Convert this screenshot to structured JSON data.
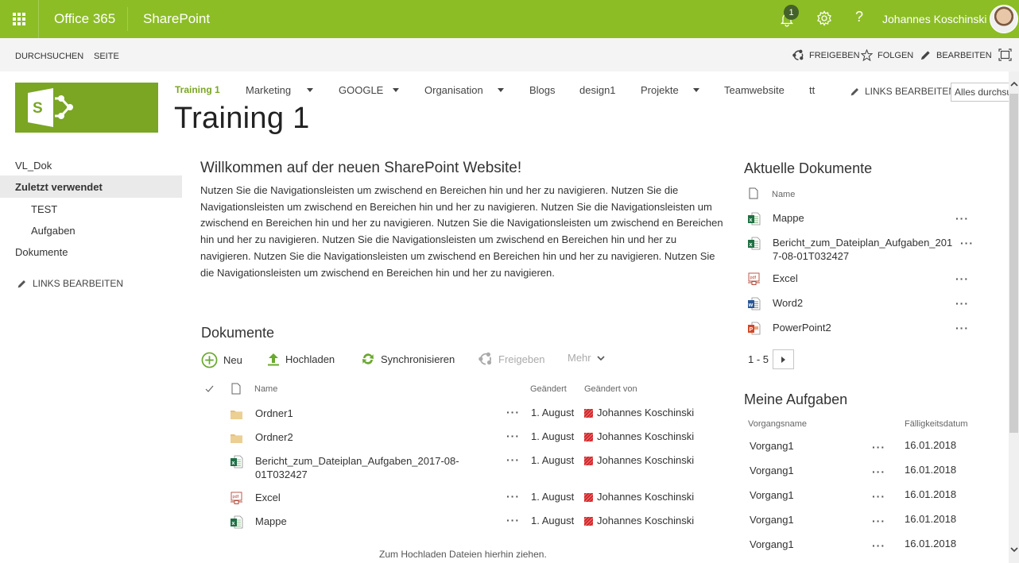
{
  "suitebar": {
    "brand": "Office 365",
    "app": "SharePoint",
    "notification_count": "1",
    "help_label": "?",
    "user_name": "Johannes Koschinski",
    "accent_color": "#8cbd25"
  },
  "ribbon": {
    "tabs": [
      "DURCHSUCHEN",
      "SEITE"
    ],
    "actions": {
      "share": "FREIGEBEN",
      "follow": "FOLGEN",
      "edit": "BEARBEITEN"
    }
  },
  "site": {
    "title": "Training 1",
    "topnav": [
      {
        "label": "Training 1",
        "active": true,
        "dropdown": false
      },
      {
        "label": "Marketing",
        "dropdown": true
      },
      {
        "label": "GOOGLE",
        "dropdown": true
      },
      {
        "label": "Organisation",
        "dropdown": true
      },
      {
        "label": "Blogs",
        "dropdown": false
      },
      {
        "label": "design1",
        "dropdown": false
      },
      {
        "label": "Projekte",
        "dropdown": true
      },
      {
        "label": "Teamwebsite",
        "dropdown": false
      },
      {
        "label": "tt",
        "dropdown": false
      }
    ],
    "links_edit": "LINKS BEARBEITEN",
    "search_value": "Alles durchsu"
  },
  "leftnav": {
    "items": [
      {
        "label": "VL_Dok"
      },
      {
        "label": "Zuletzt verwendet",
        "selected": true
      },
      {
        "label": "TEST",
        "sub": true
      },
      {
        "label": "Aufgaben",
        "sub": true
      },
      {
        "label": "Dokumente"
      }
    ],
    "links_edit": "LINKS BEARBEITEN"
  },
  "welcome": {
    "title": "Willkommen auf der neuen SharePoint Website!",
    "text": "Nutzen Sie die Navigationsleisten um zwischend en Bereichen hin und her zu navigieren.  Nutzen Sie die Navigationsleisten um zwischend en Bereichen hin und her zu navigieren.  Nutzen Sie die Navigationsleisten um zwischend en Bereichen hin und her zu navigieren.  Nutzen Sie die Navigationsleisten um zwischend en Bereichen hin und her zu navigieren.  Nutzen Sie die Navigationsleisten um zwischend en Bereichen hin und her zu navigieren.  Nutzen Sie die Navigationsleisten um zwischend en Bereichen hin und her zu navigieren.  Nutzen Sie die Navigationsleisten um zwischend en Bereichen hin und her zu navigieren."
  },
  "documents": {
    "title": "Dokumente",
    "commands": {
      "new": "Neu",
      "upload": "Hochladen",
      "sync": "Synchronisieren",
      "share": "Freigeben",
      "more": "Mehr"
    },
    "columns": {
      "name": "Name",
      "modified": "Geändert",
      "modified_by": "Geändert von"
    },
    "rows": [
      {
        "type": "folder",
        "name": "Ordner1",
        "modified": "1. August",
        "modified_by": "Johannes Koschinski"
      },
      {
        "type": "folder",
        "name": "Ordner2",
        "modified": "1. August",
        "modified_by": "Johannes Koschinski"
      },
      {
        "type": "excel",
        "name": "Bericht_zum_Dateiplan_Aufgaben_2017-08-01T032427",
        "modified": "1. August",
        "modified_by": "Johannes Koschinski"
      },
      {
        "type": "pdf",
        "name": "Excel",
        "modified": "1. August",
        "modified_by": "Johannes Koschinski"
      },
      {
        "type": "excel",
        "name": "Mappe",
        "modified": "1. August",
        "modified_by": "Johannes Koschinski"
      }
    ],
    "drop_hint": "Zum Hochladen Dateien hierhin ziehen."
  },
  "recent_docs": {
    "title": "Aktuelle Dokumente",
    "column_name": "Name",
    "items": [
      {
        "type": "excel",
        "name": "Mappe"
      },
      {
        "type": "excel",
        "name": "Bericht_zum_Dateiplan_Aufgaben_2017-08-01T032427"
      },
      {
        "type": "pdf",
        "name": "Excel"
      },
      {
        "type": "word",
        "name": "Word2"
      },
      {
        "type": "powerpoint",
        "name": "PowerPoint2"
      }
    ],
    "pager": "1 - 5"
  },
  "tasks": {
    "title": "Meine Aufgaben",
    "columns": {
      "name": "Vorgangsname",
      "due": "Fälligkeitsdatum"
    },
    "rows": [
      {
        "name": "Vorgang1",
        "due": "16.01.2018"
      },
      {
        "name": "Vorgang1",
        "due": "16.01.2018"
      },
      {
        "name": "Vorgang1",
        "due": "16.01.2018"
      },
      {
        "name": "Vorgang1",
        "due": "16.01.2018"
      },
      {
        "name": "Vorgang1",
        "due": "16.01.2018"
      }
    ]
  }
}
